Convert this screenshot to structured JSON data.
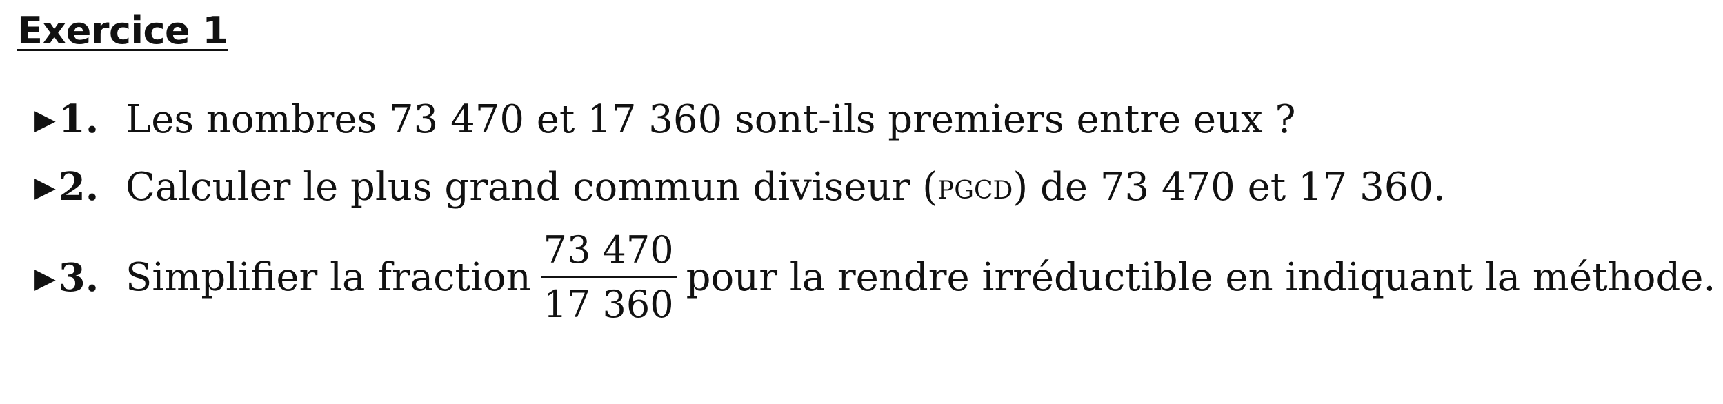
{
  "title": "Exercice 1",
  "items": [
    {
      "marker": "1.",
      "text": "Les nombres 73 470 et 17 360 sont-ils premiers entre eux ?"
    },
    {
      "marker": "2.",
      "text_before": "Calculer le plus grand commun diviseur (",
      "abbr": "PGCD",
      "text_after": ") de 73 470 et 17 360."
    },
    {
      "marker": "3.",
      "text_before": "Simplifier la fraction",
      "fraction": {
        "numerator": "73 470",
        "denominator": "17 360"
      },
      "text_after": "pour la rendre irréductible en indiquant la méthode."
    }
  ]
}
